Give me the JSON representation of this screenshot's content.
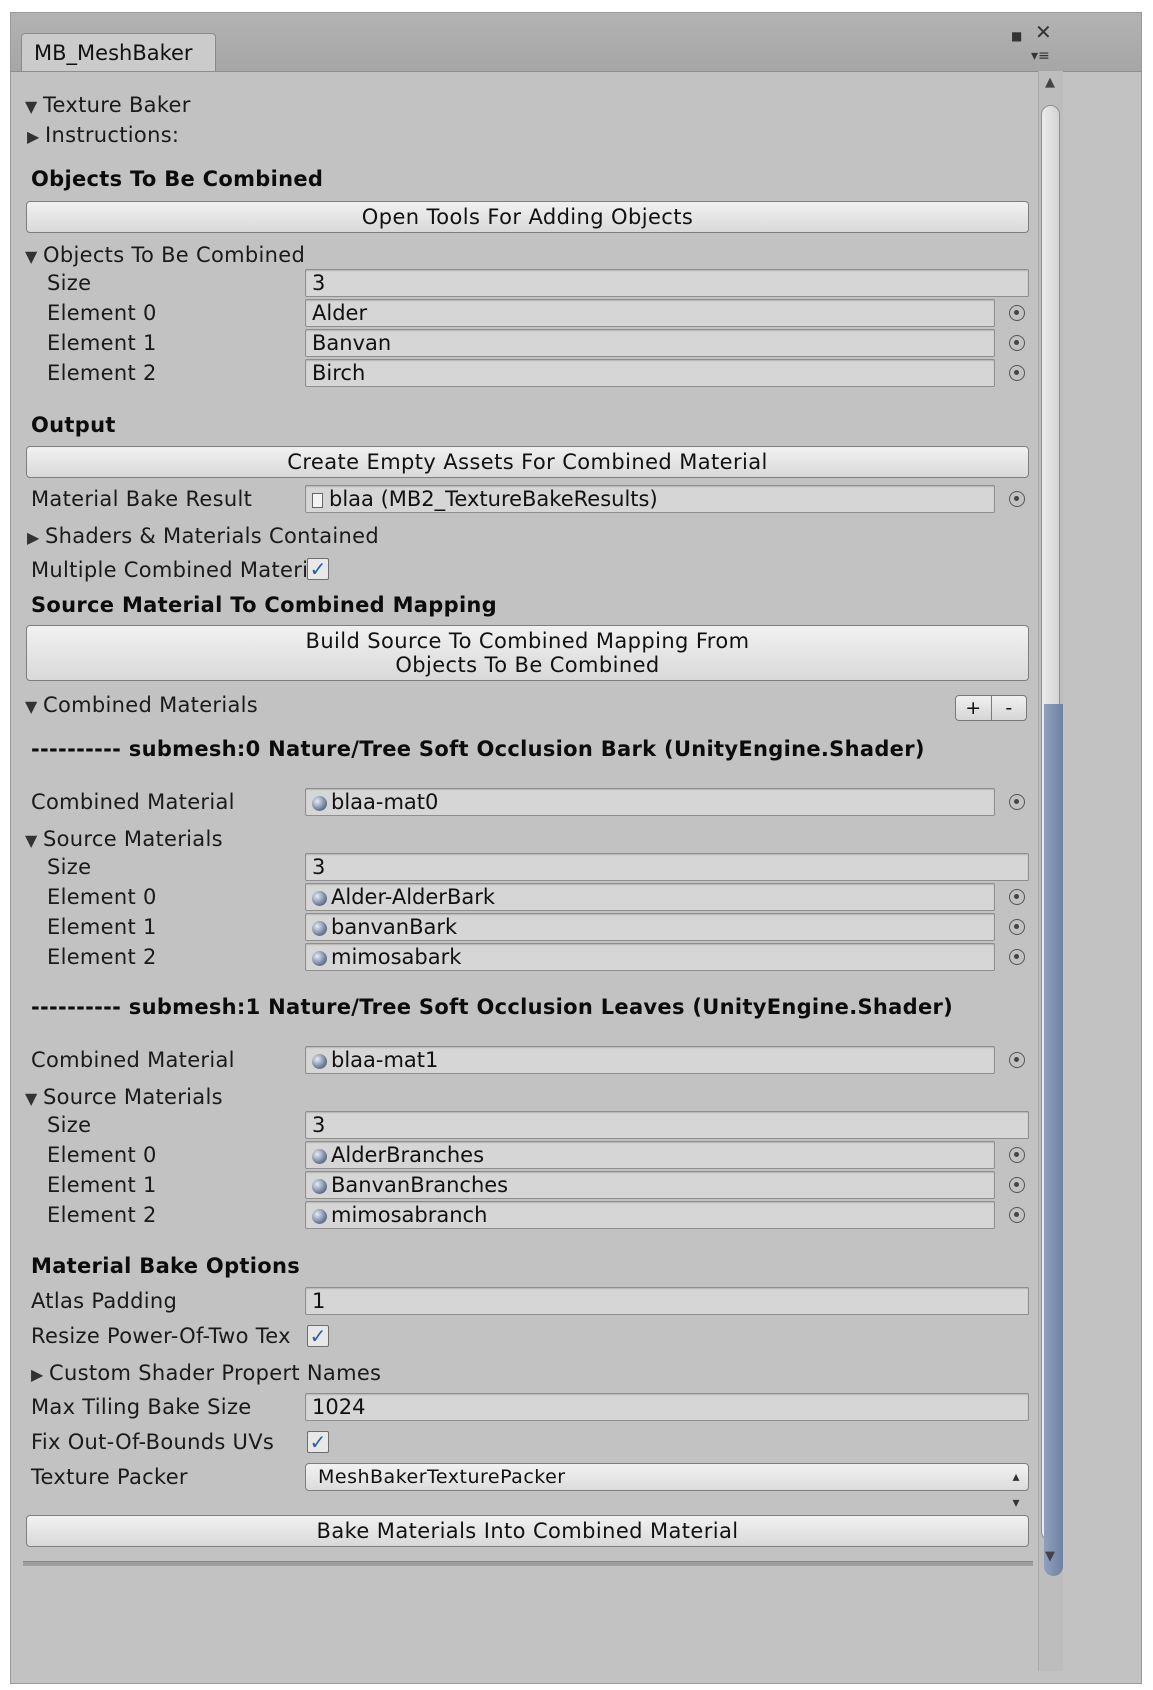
{
  "window": {
    "tab_title": "MB_MeshBaker",
    "maximize_icon": "maximize-icon",
    "close_icon": "close-icon",
    "menu_icon": "menu-icon"
  },
  "texture_baker": {
    "label": "Texture Baker"
  },
  "instructions": {
    "label": "Instructions:"
  },
  "objects_section": {
    "header": "Objects To Be Combined",
    "open_tools_button": "Open Tools For Adding Objects",
    "foldout_label": "Objects To Be Combined",
    "size_label": "Size",
    "size_value": "3",
    "elements": [
      {
        "label": "Element 0",
        "value": "Alder"
      },
      {
        "label": "Element 1",
        "value": "Banvan"
      },
      {
        "label": "Element 2",
        "value": "Birch"
      }
    ]
  },
  "output_section": {
    "header": "Output",
    "create_assets_button": "Create Empty Assets For Combined Material",
    "bake_result_label": "Material Bake Result",
    "bake_result_value": "blaa (MB2_TextureBakeResults)",
    "shaders_foldout": "Shaders & Materials Contained",
    "multiple_label": "Multiple Combined Materi",
    "multiple_checked": true
  },
  "mapping_section": {
    "header": "Source Material To Combined Mapping",
    "build_button_line1": "Build Source To Combined Mapping From",
    "build_button_line2": "Objects To Be Combined",
    "combined_materials_foldout": "Combined Materials",
    "plus_label": "+",
    "minus_label": "-"
  },
  "submeshes": [
    {
      "header": "---------- submesh:0 Nature/Tree Soft Occlusion Bark (UnityEngine.Shader)",
      "combined_label": "Combined Material",
      "combined_value": "blaa-mat0",
      "source_foldout": "Source Materials",
      "size_label": "Size",
      "size_value": "3",
      "elements": [
        {
          "label": "Element 0",
          "value": "Alder-AlderBark"
        },
        {
          "label": "Element 1",
          "value": "banvanBark"
        },
        {
          "label": "Element 2",
          "value": "mimosabark"
        }
      ]
    },
    {
      "header": "---------- submesh:1 Nature/Tree Soft Occlusion Leaves (UnityEngine.Shader)",
      "combined_label": "Combined Material",
      "combined_value": "blaa-mat1",
      "source_foldout": "Source Materials",
      "size_label": "Size",
      "size_value": "3",
      "elements": [
        {
          "label": "Element 0",
          "value": "AlderBranches"
        },
        {
          "label": "Element 1",
          "value": "BanvanBranches"
        },
        {
          "label": "Element 2",
          "value": "mimosabranch"
        }
      ]
    }
  ],
  "bake_options": {
    "header": "Material Bake Options",
    "atlas_padding_label": "Atlas Padding",
    "atlas_padding_value": "1",
    "resize_label": "Resize Power-Of-Two Tex",
    "resize_checked": true,
    "custom_shader_foldout": "Custom Shader Propert Names",
    "max_tiling_label": "Max Tiling Bake Size",
    "max_tiling_value": "1024",
    "fix_uvs_label": "Fix Out-Of-Bounds UVs",
    "fix_uvs_checked": true,
    "texture_packer_label": "Texture Packer",
    "texture_packer_value": "MeshBakerTexturePacker",
    "bake_button": "Bake Materials Into Combined Material"
  },
  "colors": {
    "panel": "#c2c2c2",
    "checkmark": "#2a5ea8",
    "scroll_accent": "#7e91b0"
  }
}
